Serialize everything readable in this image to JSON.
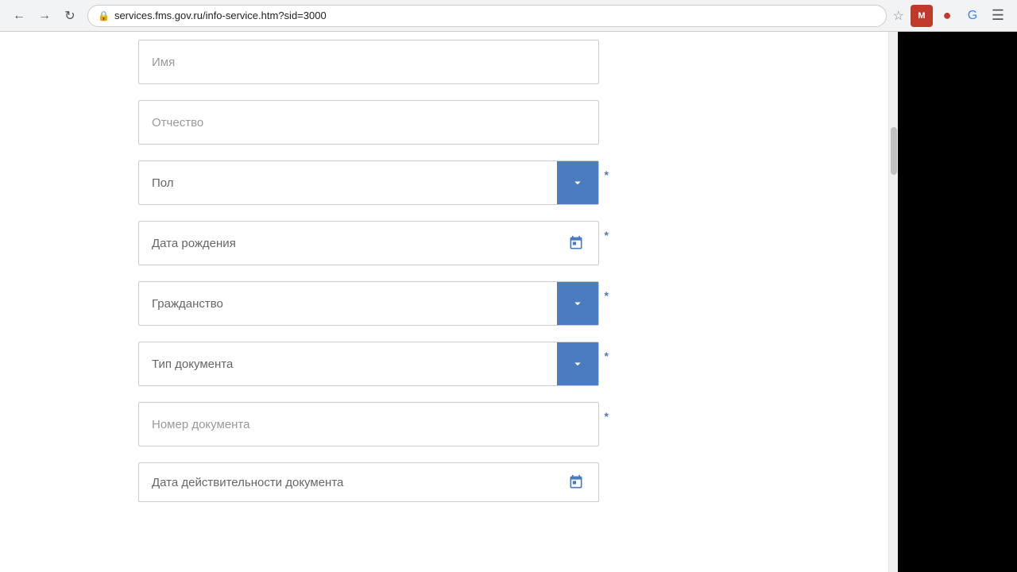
{
  "browser": {
    "url": "services.fms.gov.ru/info-service.htm?sid=3000",
    "back_title": "Back",
    "forward_title": "Forward",
    "refresh_title": "Refresh"
  },
  "form": {
    "fields": [
      {
        "id": "imya",
        "type": "text",
        "placeholder": "Имя",
        "required": false
      },
      {
        "id": "otchestvo",
        "type": "text",
        "placeholder": "Отчество",
        "required": false
      },
      {
        "id": "pol",
        "type": "select",
        "label": "Пол",
        "required": true
      },
      {
        "id": "data_rozhdeniya",
        "type": "date",
        "label": "Дата рождения",
        "required": true
      },
      {
        "id": "grazhdanstvo",
        "type": "select",
        "label": "Гражданство",
        "required": true
      },
      {
        "id": "tip_dokumenta",
        "type": "select",
        "label": "Тип документа",
        "required": true
      },
      {
        "id": "nomer_dokumenta",
        "type": "text",
        "placeholder": "Номер документа",
        "required": true
      },
      {
        "id": "data_deystvitelnosti",
        "type": "date",
        "label": "Дата действительности документа",
        "required": false
      }
    ]
  }
}
